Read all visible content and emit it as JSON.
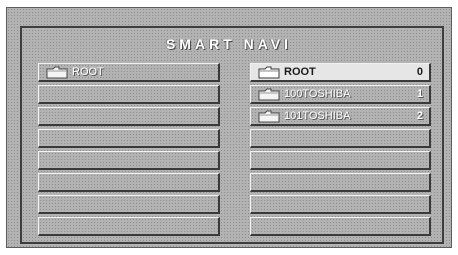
{
  "window": {
    "title": "SMART NAVI"
  },
  "left_panel": {
    "items": [
      {
        "label": "ROOT",
        "icon": "folder-icon"
      }
    ],
    "empty_rows": 7
  },
  "right_panel": {
    "items": [
      {
        "label": "ROOT",
        "number": "0",
        "icon": "folder-icon",
        "selected": true
      },
      {
        "label": "100TOSHIBA",
        "number": "1",
        "icon": "folder-icon",
        "selected": false
      },
      {
        "label": "101TOSHIBA",
        "number": "2",
        "icon": "folder-icon",
        "selected": false
      }
    ],
    "empty_rows": 5
  }
}
